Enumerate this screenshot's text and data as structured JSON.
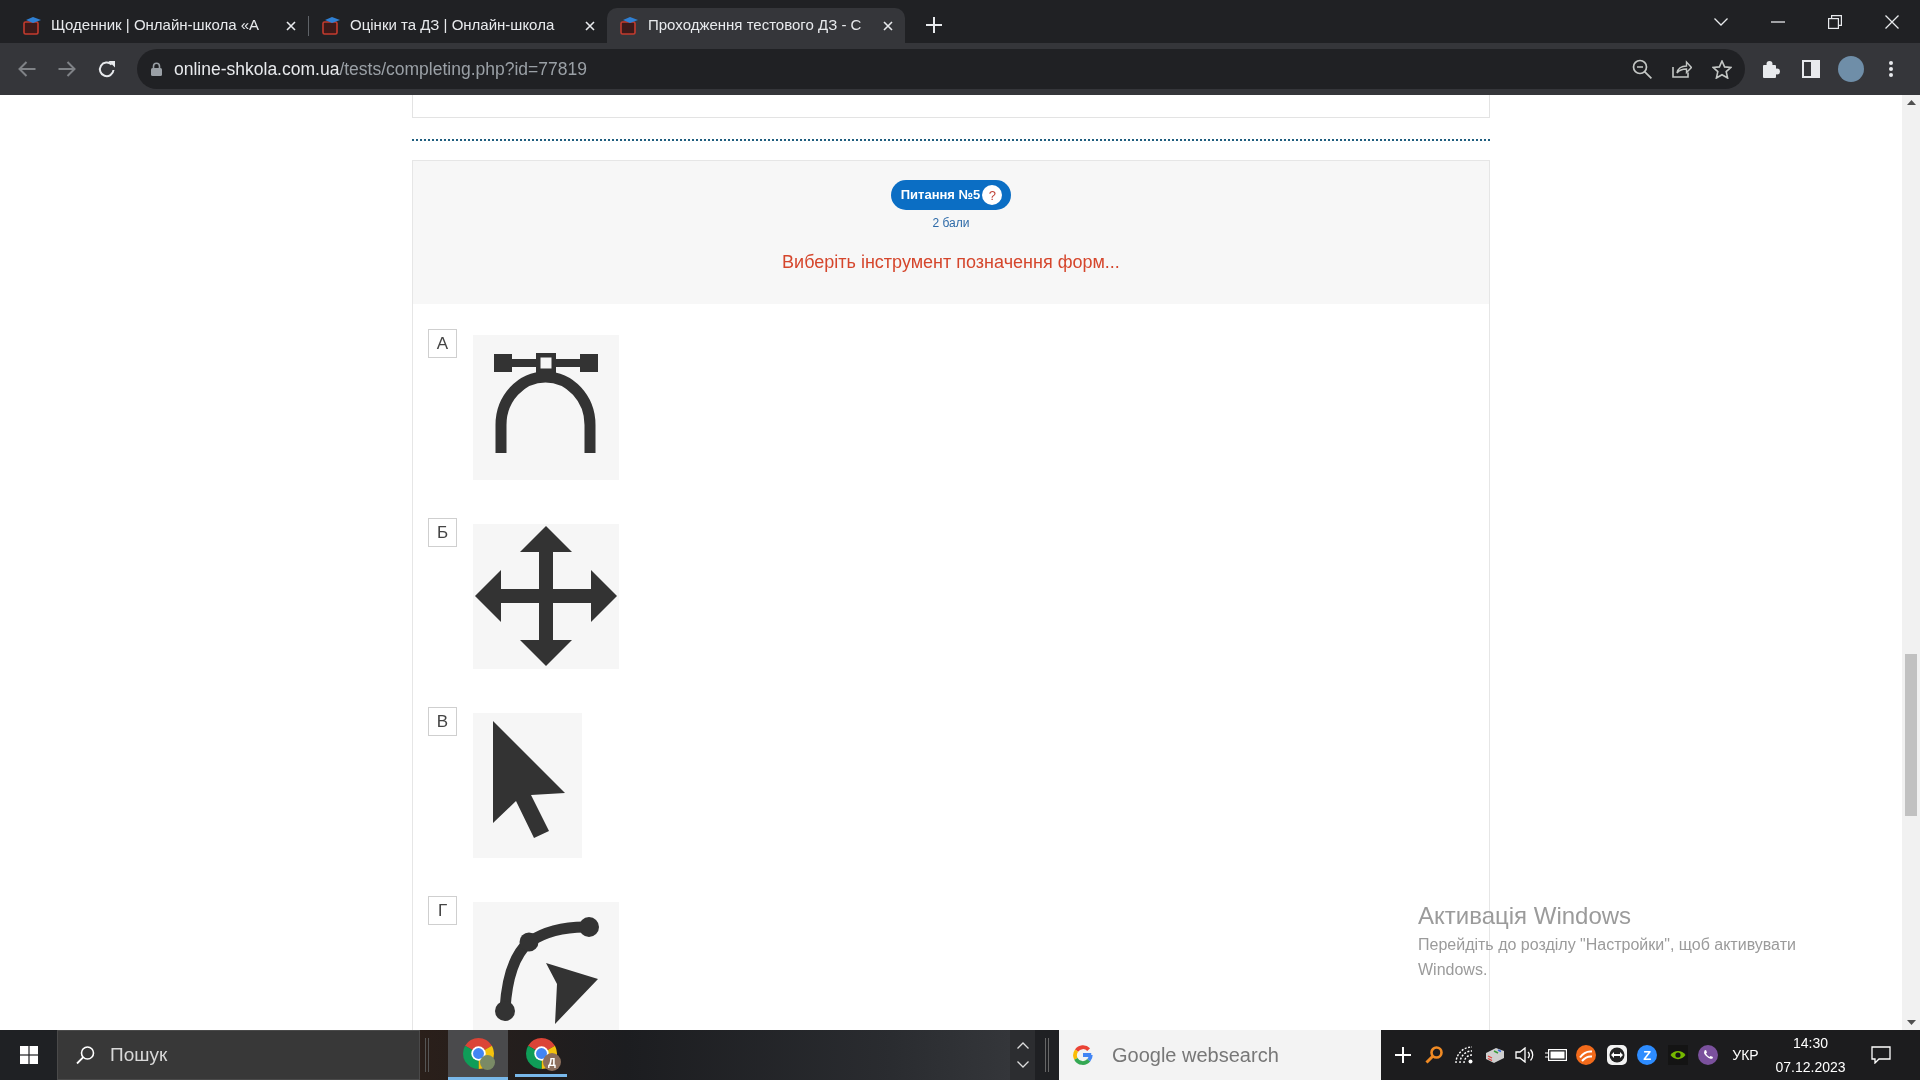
{
  "browser": {
    "tabs": [
      {
        "title": "Щоденник | Онлайн-школа «А",
        "selected": false
      },
      {
        "title": "Оцінки та ДЗ | Онлайн-школа",
        "selected": false
      },
      {
        "title": "Проходження тестового ДЗ - С",
        "selected": true
      }
    ],
    "toolbar": {
      "back": {
        "disabled": true
      },
      "forward": {
        "disabled": true
      }
    },
    "address": {
      "host": "online-shkola.com.ua",
      "path": "/tests/completing.php?id=77819"
    }
  },
  "question": {
    "number": "Питання №5",
    "help": "?",
    "points": "2 бали",
    "text": "Виберіть інструмент позначення форм..."
  },
  "options": [
    {
      "letter": "А",
      "kind": "curve-handles",
      "selected": false
    },
    {
      "letter": "Б",
      "kind": "move",
      "selected": false
    },
    {
      "letter": "В",
      "kind": "pointer",
      "selected": false
    },
    {
      "letter": "Г",
      "kind": "curve-pointer",
      "selected": false
    }
  ],
  "activation": {
    "title": "Активація Windows",
    "text": "Перейдіть до розділу \"Настройки\", щоб активувати Windows."
  },
  "taskbar": {
    "search": {
      "placeholder": "Пошук"
    },
    "apps": [
      {
        "kind": "avatar",
        "selected": true
      },
      {
        "kind": "letter",
        "badge": "Д",
        "selected": false
      }
    ],
    "web_search": {
      "placeholder": "Google websearch"
    },
    "tray_badge": "Z",
    "language": "УКР",
    "time": "14:30",
    "date": "07.12.2023"
  }
}
